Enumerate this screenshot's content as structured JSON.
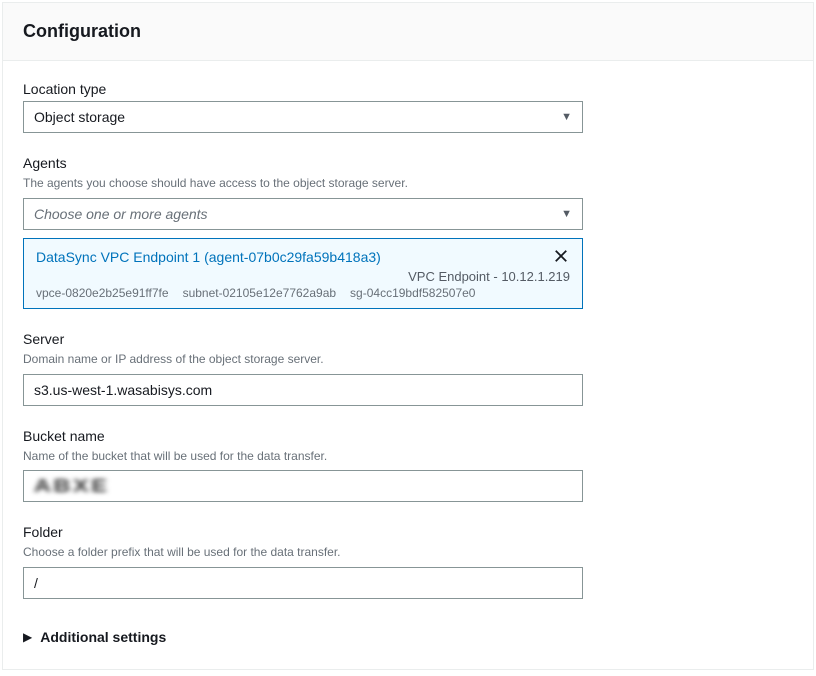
{
  "header": {
    "title": "Configuration"
  },
  "location_type": {
    "label": "Location type",
    "value": "Object storage"
  },
  "agents": {
    "label": "Agents",
    "hint": "The agents you choose should have access to the object storage server.",
    "placeholder": "Choose one or more agents",
    "selected": {
      "title": "DataSync VPC Endpoint 1 (agent-07b0c29fa59b418a3)",
      "subtitle": "VPC Endpoint - 10.12.1.219",
      "meta1": "vpce-0820e2b25e91ff7fe",
      "meta2": "subnet-02105e12e7762a9ab",
      "meta3": "sg-04cc19bdf582507e0"
    }
  },
  "server": {
    "label": "Server",
    "hint": "Domain name or IP address of the object storage server.",
    "value": "s3.us-west-1.wasabisys.com"
  },
  "bucket": {
    "label": "Bucket name",
    "hint": "Name of the bucket that will be used for the data transfer.",
    "value_obscured": "ABXE"
  },
  "folder": {
    "label": "Folder",
    "hint": "Choose a folder prefix that will be used for the data transfer.",
    "value": "/"
  },
  "additional": {
    "label": "Additional settings"
  }
}
